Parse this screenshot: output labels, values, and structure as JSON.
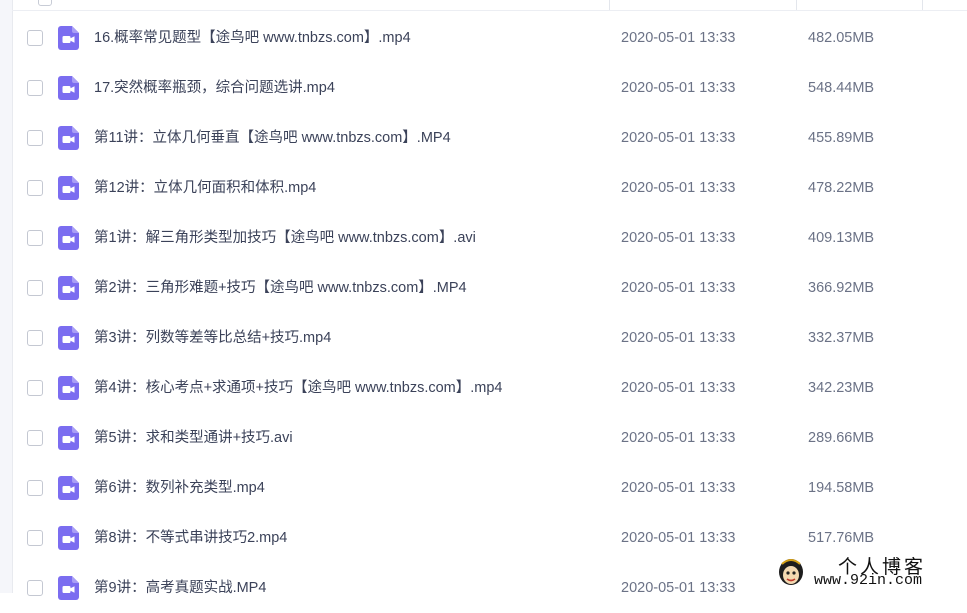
{
  "files": [
    {
      "name": "16.概率常见题型【途鸟吧 www.tnbzs.com】.mp4",
      "date": "2020-05-01 13:33",
      "size": "482.05MB"
    },
    {
      "name": "17.突然概率瓶颈，综合问题选讲.mp4",
      "date": "2020-05-01 13:33",
      "size": "548.44MB"
    },
    {
      "name": "第11讲：立体几何垂直【途鸟吧 www.tnbzs.com】.MP4",
      "date": "2020-05-01 13:33",
      "size": "455.89MB"
    },
    {
      "name": "第12讲：立体几何面积和体积.mp4",
      "date": "2020-05-01 13:33",
      "size": "478.22MB"
    },
    {
      "name": "第1讲：解三角形类型加技巧【途鸟吧 www.tnbzs.com】.avi",
      "date": "2020-05-01 13:33",
      "size": "409.13MB"
    },
    {
      "name": "第2讲：三角形难题+技巧【途鸟吧 www.tnbzs.com】.MP4",
      "date": "2020-05-01 13:33",
      "size": "366.92MB"
    },
    {
      "name": "第3讲：列数等差等比总结+技巧.mp4",
      "date": "2020-05-01 13:33",
      "size": "332.37MB"
    },
    {
      "name": "第4讲：核心考点+求通项+技巧【途鸟吧 www.tnbzs.com】.mp4",
      "date": "2020-05-01 13:33",
      "size": "342.23MB"
    },
    {
      "name": "第5讲：求和类型通讲+技巧.avi",
      "date": "2020-05-01 13:33",
      "size": "289.66MB"
    },
    {
      "name": "第6讲：数列补充类型.mp4",
      "date": "2020-05-01 13:33",
      "size": "194.58MB"
    },
    {
      "name": "第8讲：不等式串讲技巧2.mp4",
      "date": "2020-05-01 13:33",
      "size": "517.76MB"
    },
    {
      "name": "第9讲：高考真题实战.MP4",
      "date": "2020-05-01 13:33",
      "size": ""
    }
  ],
  "watermark": {
    "title": "个人博客",
    "url": "www.92in.com"
  },
  "colors": {
    "icon": "#7b6df0",
    "text": "#3b4259",
    "muted": "#6b7286"
  },
  "icons": {
    "file": "video-file-icon",
    "watermark": "cartoon-avatar-logo"
  }
}
